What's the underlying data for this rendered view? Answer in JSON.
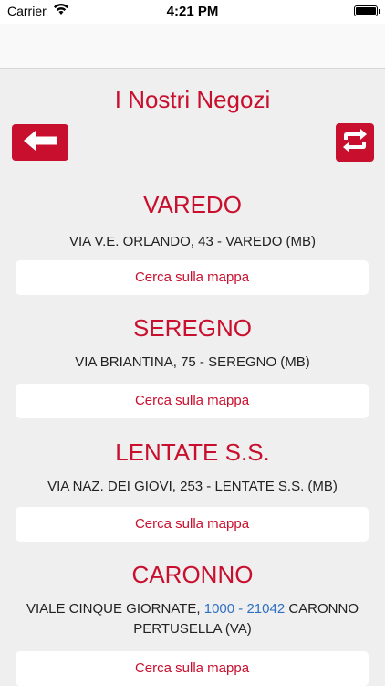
{
  "status_bar": {
    "carrier": "Carrier",
    "time": "4:21 PM"
  },
  "page": {
    "title": "I Nostri Negozi"
  },
  "map_button_label": "Cerca sulla mappa",
  "stores": [
    {
      "name": "VAREDO",
      "address": "VIA V.E. ORLANDO, 43 - VAREDO (MB)"
    },
    {
      "name": "SEREGNO",
      "address": "VIA BRIANTINA, 75 - SEREGNO (MB)"
    },
    {
      "name": "LENTATE S.S.",
      "address": "VIA NAZ. DEI GIOVI, 253 - LENTATE S.S. (MB)"
    },
    {
      "name": "CARONNO",
      "address_prefix": "VIALE CINQUE GIORNATE, ",
      "address_link": "1000 - 21042",
      "address_suffix": " CARONNO PERTUSELLA (VA)"
    }
  ],
  "colors": {
    "accent": "#c8102e",
    "link": "#2f6fc2",
    "background": "#efefef"
  }
}
